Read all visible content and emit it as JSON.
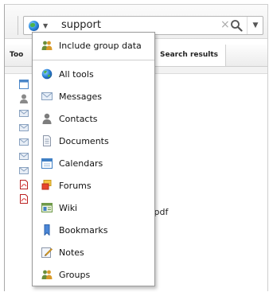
{
  "search": {
    "query": "support"
  },
  "tabs": {
    "tools_label": "Too",
    "results_label": "Search results"
  },
  "background": {
    "pdf_suffix": ".pdf"
  },
  "menu": {
    "header_label": "Include group data",
    "items": [
      {
        "label": "All tools",
        "icon": "globe-icon"
      },
      {
        "label": "Messages",
        "icon": "envelope-icon"
      },
      {
        "label": "Contacts",
        "icon": "person-icon"
      },
      {
        "label": "Documents",
        "icon": "document-icon"
      },
      {
        "label": "Calendars",
        "icon": "calendar-icon"
      },
      {
        "label": "Forums",
        "icon": "forum-icon"
      },
      {
        "label": "Wiki",
        "icon": "wiki-icon"
      },
      {
        "label": "Bookmarks",
        "icon": "bookmark-icon"
      },
      {
        "label": "Notes",
        "icon": "note-icon"
      },
      {
        "label": "Groups",
        "icon": "groups-icon"
      }
    ]
  }
}
